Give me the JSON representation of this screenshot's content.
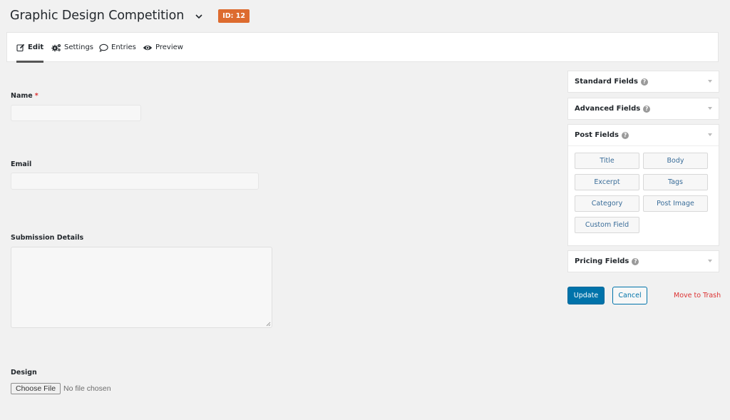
{
  "header": {
    "title": "Graphic Design Competition",
    "id_badge": "ID: 12",
    "badge_color": "#dd6b2f"
  },
  "tabs": [
    {
      "label": "Edit",
      "icon": "pencil-edit-icon",
      "active": true
    },
    {
      "label": "Settings",
      "icon": "gears-icon",
      "active": false
    },
    {
      "label": "Entries",
      "icon": "speech-bubble-icon",
      "active": false
    },
    {
      "label": "Preview",
      "icon": "eye-icon",
      "active": false
    }
  ],
  "form": {
    "name_label": "Name",
    "required_mark": "*",
    "name_value": "",
    "email_label": "Email",
    "email_value": "",
    "details_label": "Submission Details",
    "details_value": "",
    "design_label": "Design",
    "choose_file_label": "Choose File",
    "no_file_text": "No file chosen"
  },
  "sidebar": {
    "help_glyph": "?",
    "standard_fields": "Standard Fields",
    "advanced_fields": "Advanced Fields",
    "post_fields": "Post Fields",
    "pricing_fields": "Pricing Fields",
    "post_field_buttons": [
      "Title",
      "Body",
      "Excerpt",
      "Tags",
      "Category",
      "Post Image",
      "Custom Field"
    ]
  },
  "actions": {
    "update_label": "Update",
    "cancel_label": "Cancel",
    "trash_label": "Move to Trash",
    "primary_color": "#0073aa",
    "danger_color": "#dc3232"
  }
}
